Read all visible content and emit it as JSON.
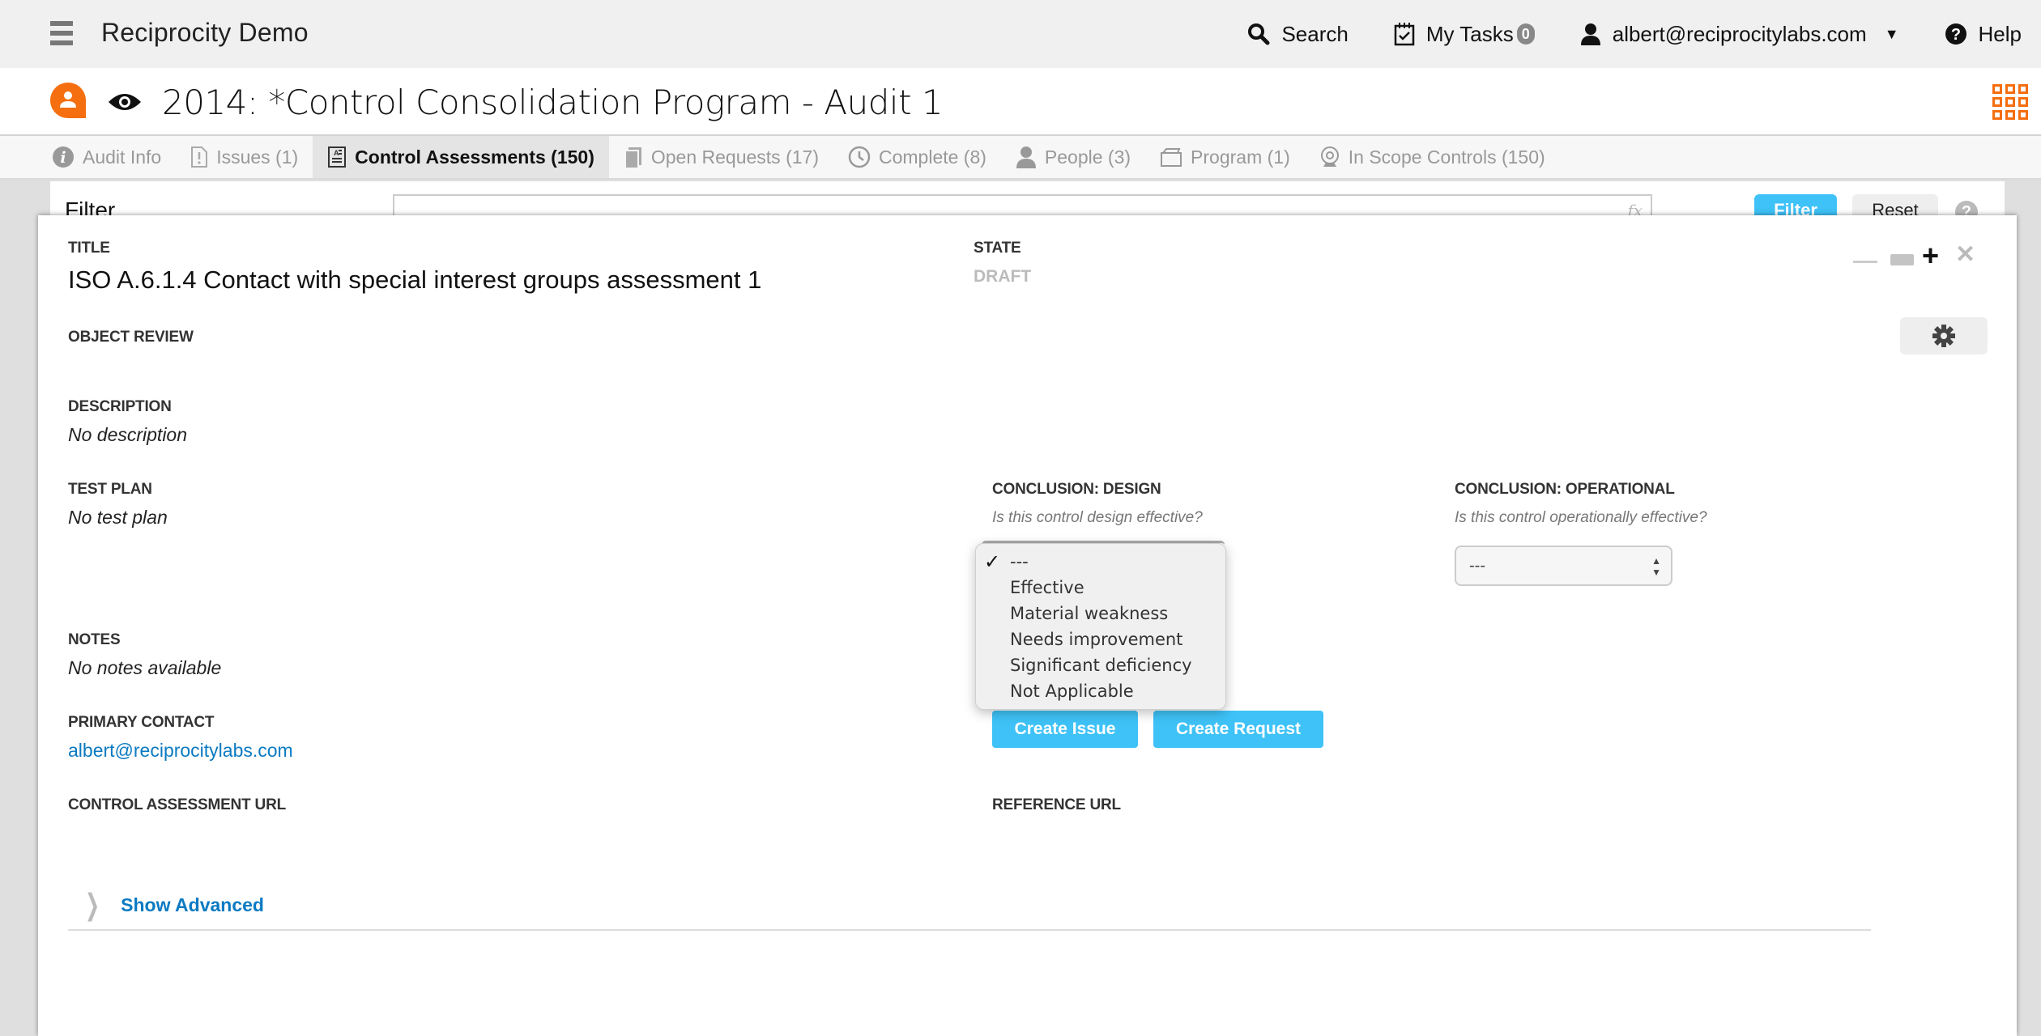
{
  "topbar": {
    "app_name": "Reciprocity Demo",
    "search_label": "Search",
    "tasks_label": "My Tasks",
    "tasks_count": "0",
    "user_email": "albert@reciprocitylabs.com",
    "help_label": "Help"
  },
  "titlebar": {
    "page_title": "2014: *Control Consolidation Program - Audit 1"
  },
  "tabs": [
    {
      "label": "Audit Info",
      "icon": "info-icon"
    },
    {
      "label": "Issues (1)",
      "icon": "issue-icon"
    },
    {
      "label": "Control Assessments (150)",
      "icon": "assessment-icon",
      "active": true
    },
    {
      "label": "Open Requests (17)",
      "icon": "request-icon"
    },
    {
      "label": "Complete (8)",
      "icon": "clock-icon"
    },
    {
      "label": "People (3)",
      "icon": "person-icon"
    },
    {
      "label": "Program (1)",
      "icon": "folder-icon"
    },
    {
      "label": "In Scope Controls (150)",
      "icon": "control-icon"
    }
  ],
  "filter": {
    "label": "Filter",
    "value": "",
    "fx_label": "fx",
    "filter_button": "Filter",
    "reset_button": "Reset",
    "help_glyph": "?"
  },
  "panel": {
    "title_label": "TITLE",
    "title_value": "ISO A.6.1.4 Contact with special interest groups assessment 1",
    "state_label": "STATE",
    "state_value": "DRAFT",
    "object_review_label": "OBJECT REVIEW",
    "description_label": "DESCRIPTION",
    "description_value": "No description",
    "test_plan_label": "TEST PLAN",
    "test_plan_value": "No test plan",
    "notes_label": "NOTES",
    "notes_value": "No notes available",
    "primary_contact_label": "PRIMARY CONTACT",
    "primary_contact_value": "albert@reciprocitylabs.com",
    "assessment_url_label": "CONTROL ASSESSMENT URL",
    "reference_url_label": "REFERENCE URL",
    "conclusion_design": {
      "label": "CONCLUSION: DESIGN",
      "help": "Is this control design effective?",
      "selected": "---",
      "options": [
        "---",
        "Effective",
        "Material weakness",
        "Needs improvement",
        "Significant deficiency",
        "Not Applicable"
      ]
    },
    "conclusion_operational": {
      "label": "CONCLUSION: OPERATIONAL",
      "help": "Is this control operationally effective?",
      "selected": "---"
    },
    "create_issue_button": "Create Issue",
    "create_request_button": "Create Request",
    "show_advanced": "Show Advanced"
  },
  "colors": {
    "accent_orange": "#f56e0f",
    "button_blue": "#3ec2f7",
    "link_blue": "#0b7ac2"
  }
}
